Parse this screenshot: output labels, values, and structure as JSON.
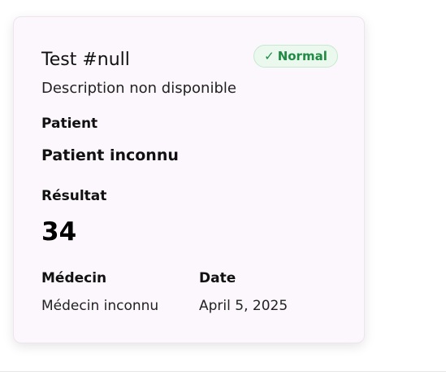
{
  "card": {
    "title": "Test #null",
    "status": {
      "check_icon": "✓",
      "label": "Normal",
      "color": "#1f8b45",
      "background": "#eaf8ee"
    },
    "description": "Description non disponible",
    "patient": {
      "label": "Patient",
      "value": "Patient inconnu"
    },
    "result": {
      "label": "Résultat",
      "value": "34"
    },
    "doctor": {
      "label": "Médecin",
      "value": "Médecin inconnu"
    },
    "date": {
      "label": "Date",
      "value": "April 5, 2025"
    }
  }
}
